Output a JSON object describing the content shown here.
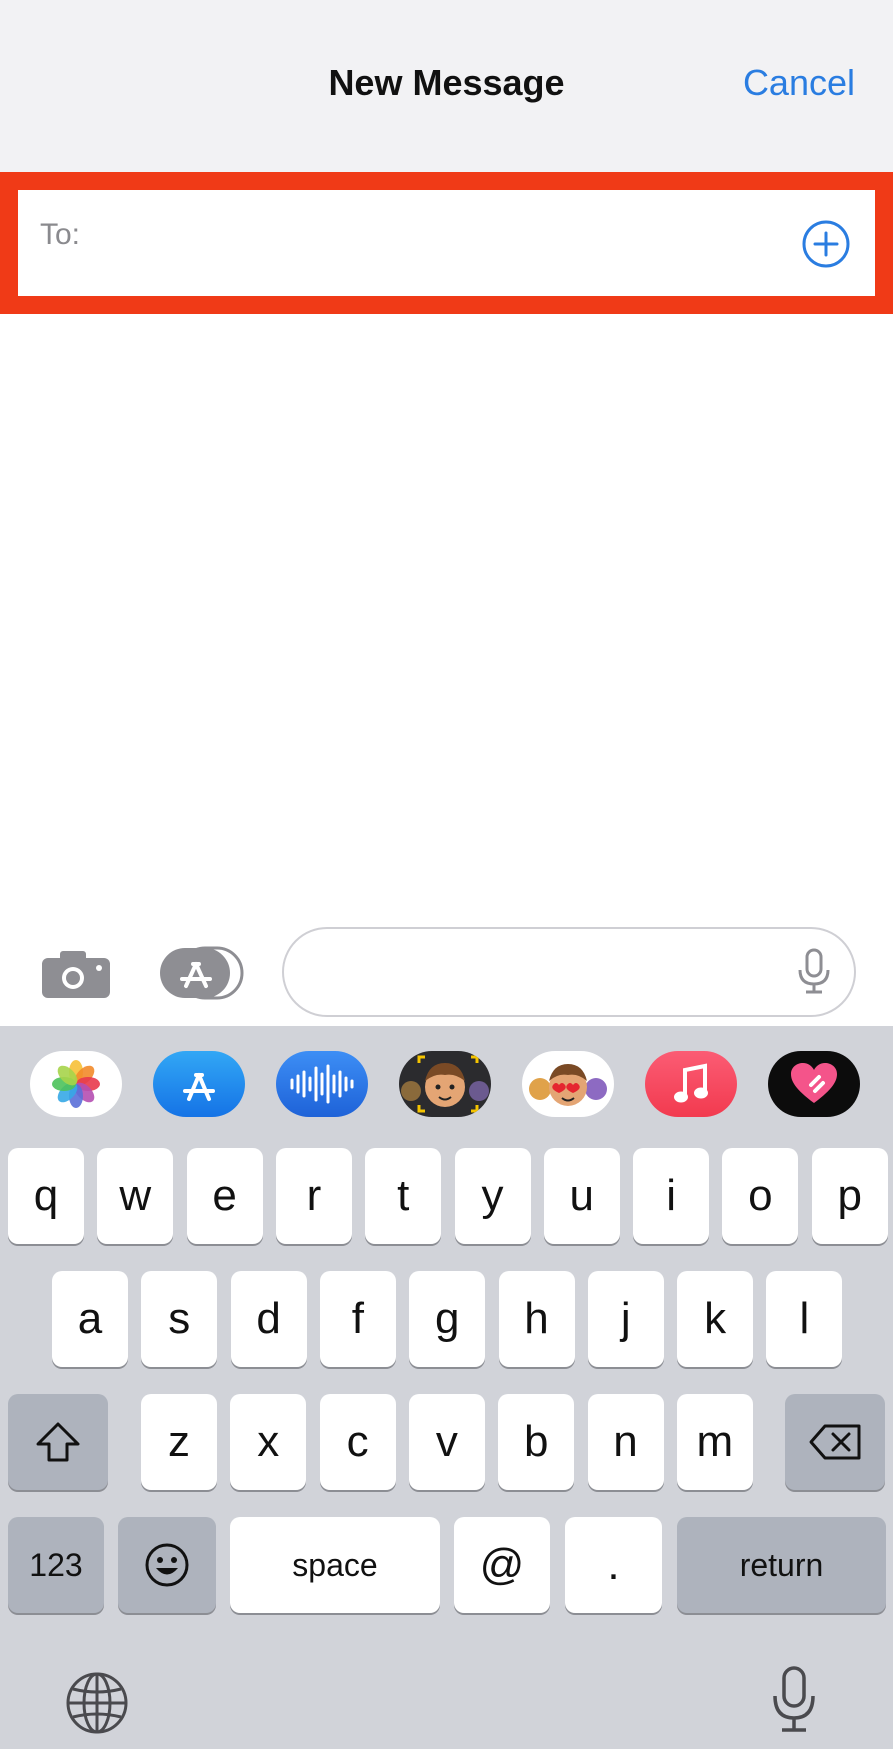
{
  "header": {
    "title": "New Message",
    "cancel_label": "Cancel"
  },
  "recipient": {
    "label": "To:",
    "add_icon": "plus-circle-icon",
    "highlight_color": "#f03a17"
  },
  "compose": {
    "camera_icon": "camera-icon",
    "apps_icon": "app-store-icon",
    "mic_icon": "microphone-icon"
  },
  "app_strip": [
    {
      "name": "photos-app-icon"
    },
    {
      "name": "app-store-app-icon"
    },
    {
      "name": "audio-message-app-icon"
    },
    {
      "name": "memoji-app-icon"
    },
    {
      "name": "memoji-stickers-app-icon"
    },
    {
      "name": "music-app-icon"
    },
    {
      "name": "digital-touch-app-icon"
    }
  ],
  "keyboard": {
    "row1": [
      "q",
      "w",
      "e",
      "r",
      "t",
      "y",
      "u",
      "i",
      "o",
      "p"
    ],
    "row2": [
      "a",
      "s",
      "d",
      "f",
      "g",
      "h",
      "j",
      "k",
      "l"
    ],
    "row3": [
      "z",
      "x",
      "c",
      "v",
      "b",
      "n",
      "m"
    ],
    "numbers_label": "123",
    "space_label": "space",
    "at_label": "@",
    "period_label": ".",
    "return_label": "return",
    "shift_icon": "shift-icon",
    "backspace_icon": "backspace-icon",
    "emoji_icon": "emoji-icon",
    "globe_icon": "globe-icon",
    "dictation_icon": "microphone-icon"
  },
  "colors": {
    "accent": "#2a7de1",
    "keyboard_bg": "#d1d3d9",
    "header_bg": "#f2f2f4"
  }
}
